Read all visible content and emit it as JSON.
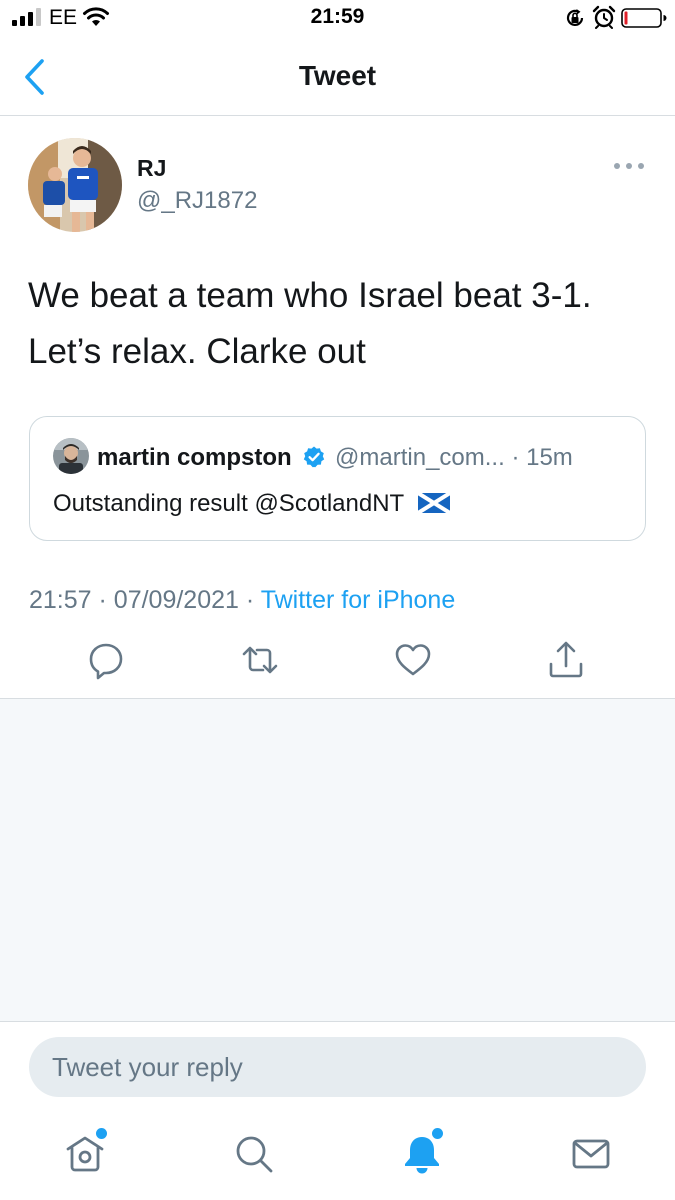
{
  "status_bar": {
    "carrier": "EE",
    "time": "21:59",
    "icons": [
      "signal-icon",
      "wifi-icon",
      "orientation-lock-icon",
      "alarm-icon",
      "battery-icon"
    ]
  },
  "nav": {
    "title": "Tweet",
    "back_icon": "chevron-left-icon"
  },
  "tweet": {
    "author_name": "RJ",
    "author_handle": "@_RJ1872",
    "text_line1": "We beat a team who Israel beat 3-1.",
    "text_line2": "Let’s relax. Clarke out",
    "quoted": {
      "name": "martin compston",
      "handle": "@martin_com...",
      "time": "· 15m",
      "text": "Outstanding result @ScotlandNT",
      "flag_icon": "scotland-flag-icon"
    },
    "time": "21:57",
    "separator": "·",
    "date": "07/09/2021",
    "source": "Twitter for iPhone"
  },
  "actions": [
    "reply-icon",
    "retweet-icon",
    "like-icon",
    "share-icon"
  ],
  "reply": {
    "placeholder": "Tweet your reply"
  },
  "tab_bar": [
    "home-icon",
    "search-icon",
    "notifications-icon",
    "messages-icon"
  ],
  "colors": {
    "accent": "#1da1f2",
    "text_primary": "#14171a",
    "text_secondary": "#657786",
    "border": "#d8dde1",
    "empty_background": "#f5f8fa",
    "reply_background": "#e6ecf0"
  }
}
